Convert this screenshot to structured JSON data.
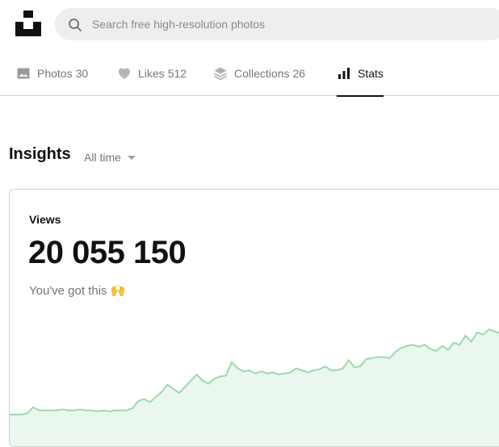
{
  "search": {
    "placeholder": "Search free high-resolution photos",
    "icon": "search-icon"
  },
  "logo": {
    "icon": "unsplash-logo-icon"
  },
  "tabs": [
    {
      "label": "Photos",
      "count": "30",
      "icon": "image-icon",
      "active": false
    },
    {
      "label": "Likes",
      "count": "512",
      "icon": "heart-icon",
      "active": false
    },
    {
      "label": "Collections",
      "count": "26",
      "icon": "stack-icon",
      "active": false
    },
    {
      "label": "Stats",
      "count": "",
      "icon": "bar-chart-icon",
      "active": true
    }
  ],
  "insights": {
    "title": "Insights",
    "range": "All time"
  },
  "views": {
    "label": "Views",
    "value": "20 055 150",
    "note": "You've got this 🙌"
  },
  "colors": {
    "accent_line": "#9ed8ab",
    "accent_fill": "#e9f7ee",
    "text_primary": "#111111",
    "text_muted": "#767676"
  },
  "chart_data": {
    "type": "area",
    "values": [
      0.05,
      0.05,
      0.05,
      0.06,
      0.12,
      0.09,
      0.09,
      0.09,
      0.09,
      0.1,
      0.09,
      0.09,
      0.1,
      0.09,
      0.09,
      0.08,
      0.09,
      0.08,
      0.09,
      0.09,
      0.09,
      0.11,
      0.18,
      0.2,
      0.17,
      0.22,
      0.27,
      0.34,
      0.3,
      0.26,
      0.32,
      0.38,
      0.44,
      0.38,
      0.35,
      0.4,
      0.42,
      0.43,
      0.56,
      0.5,
      0.47,
      0.48,
      0.45,
      0.47,
      0.45,
      0.46,
      0.44,
      0.45,
      0.46,
      0.5,
      0.48,
      0.46,
      0.48,
      0.49,
      0.52,
      0.48,
      0.48,
      0.5,
      0.58,
      0.51,
      0.52,
      0.59,
      0.6,
      0.61,
      0.61,
      0.6,
      0.66,
      0.7,
      0.72,
      0.73,
      0.71,
      0.73,
      0.69,
      0.67,
      0.72,
      0.68,
      0.75,
      0.73,
      0.82,
      0.76,
      0.85,
      0.83,
      0.88,
      0.86,
      0.84
    ]
  }
}
